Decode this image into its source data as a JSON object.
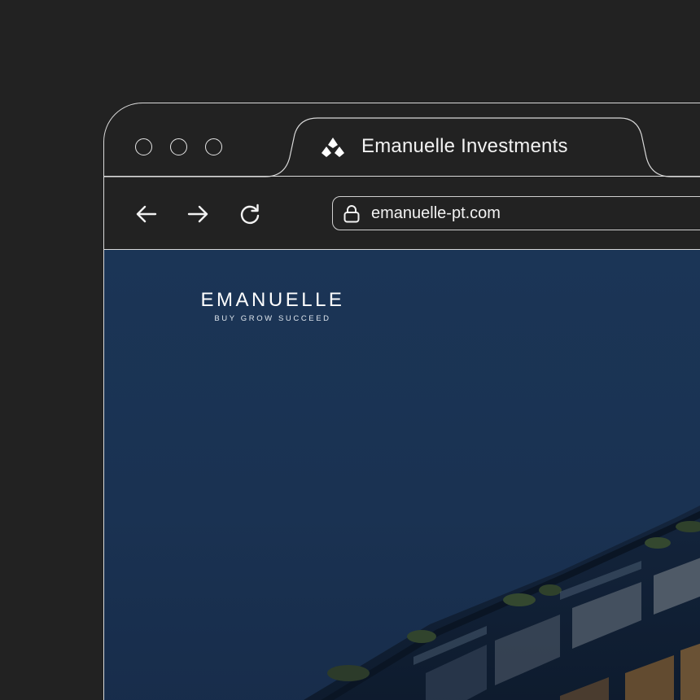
{
  "window": {
    "controls": [
      "close",
      "minimize",
      "maximize"
    ]
  },
  "tab": {
    "icon": "brand-diamond-icon",
    "title": "Emanuelle Investments"
  },
  "toolbar": {
    "back_icon": "arrow-left-icon",
    "forward_icon": "arrow-right-icon",
    "reload_icon": "reload-icon"
  },
  "address_bar": {
    "icon": "lock-icon",
    "url": "emanuelle-pt.com"
  },
  "page": {
    "brand": {
      "name": "EMANUELLE",
      "tagline": "BUY  GROW  SUCCEED"
    },
    "hero_image": "night-building-facade"
  },
  "colors": {
    "background": "#222222",
    "browser_chrome": "#222222",
    "outline": "#d9d9d9",
    "hero_sky": "#1b3556"
  }
}
